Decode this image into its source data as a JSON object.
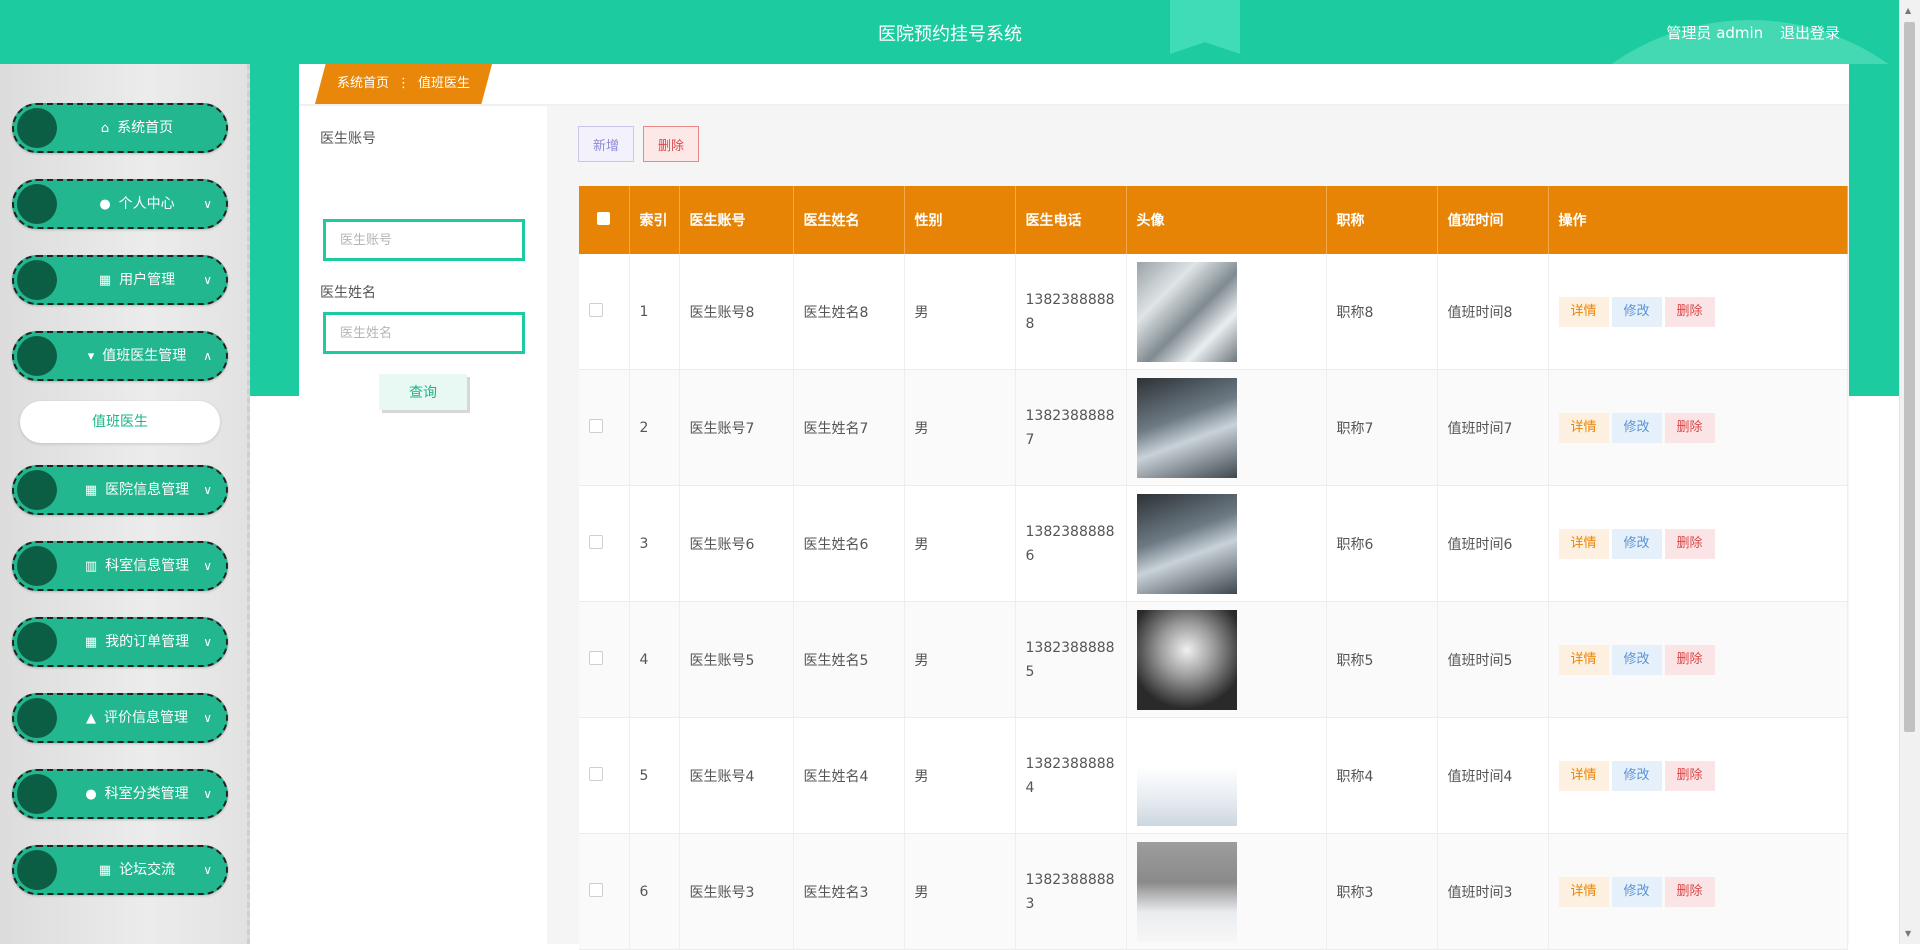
{
  "header": {
    "title": "医院预约挂号系统",
    "user": "管理员 admin",
    "logout": "退出登录"
  },
  "sidebar": {
    "items": [
      {
        "label": "系统首页",
        "icon": "home-icon",
        "glyph": "⌂",
        "chevron": ""
      },
      {
        "label": "个人中心",
        "icon": "user-icon",
        "glyph": "●",
        "chevron": "∨"
      },
      {
        "label": "用户管理",
        "icon": "grid-icon",
        "glyph": "▦",
        "chevron": "∨"
      },
      {
        "label": "值班医生管理",
        "icon": "pin-icon",
        "glyph": "▾",
        "chevron": "∧"
      },
      {
        "label": "医院信息管理",
        "icon": "grid-icon",
        "glyph": "▦",
        "chevron": "∨"
      },
      {
        "label": "科室信息管理",
        "icon": "book-icon",
        "glyph": "▥",
        "chevron": "∨"
      },
      {
        "label": "我的订单管理",
        "icon": "grid-icon",
        "glyph": "▦",
        "chevron": "∨"
      },
      {
        "label": "评价信息管理",
        "icon": "thumb-icon",
        "glyph": "▲",
        "chevron": "∨"
      },
      {
        "label": "科室分类管理",
        "icon": "user-icon",
        "glyph": "●",
        "chevron": "∨"
      },
      {
        "label": "论坛交流",
        "icon": "table-icon",
        "glyph": "▦",
        "chevron": "∨"
      }
    ],
    "active_sub": "值班医生"
  },
  "breadcrumb": {
    "home": "系统首页",
    "sep": "⋮",
    "current": "值班医生"
  },
  "filter": {
    "account_label": "医生账号",
    "account_placeholder": "医生账号",
    "name_label": "医生姓名",
    "name_placeholder": "医生姓名",
    "query": "查询"
  },
  "actions": {
    "add": "新增",
    "delete": "删除"
  },
  "table": {
    "headers": [
      "索引",
      "医生账号",
      "医生姓名",
      "性别",
      "医生电话",
      "头像",
      "职称",
      "值班时间",
      "操作"
    ],
    "rows": [
      {
        "idx": "1",
        "account": "医生账号8",
        "name": "医生姓名8",
        "gender": "男",
        "phone": "13823888888",
        "title": "职称8",
        "duty": "值班时间8"
      },
      {
        "idx": "2",
        "account": "医生账号7",
        "name": "医生姓名7",
        "gender": "男",
        "phone": "13823888887",
        "title": "职称7",
        "duty": "值班时间7"
      },
      {
        "idx": "3",
        "account": "医生账号6",
        "name": "医生姓名6",
        "gender": "男",
        "phone": "13823888886",
        "title": "职称6",
        "duty": "值班时间6"
      },
      {
        "idx": "4",
        "account": "医生账号5",
        "name": "医生姓名5",
        "gender": "男",
        "phone": "13823888885",
        "title": "职称5",
        "duty": "值班时间5"
      },
      {
        "idx": "5",
        "account": "医生账号4",
        "name": "医生姓名4",
        "gender": "男",
        "phone": "13823888884",
        "title": "职称4",
        "duty": "值班时间4"
      },
      {
        "idx": "6",
        "account": "医生账号3",
        "name": "医生姓名3",
        "gender": "男",
        "phone": "13823888883",
        "title": "职称3",
        "duty": "值班时间3"
      }
    ],
    "row_actions": {
      "detail": "详情",
      "edit": "修改",
      "delete": "删除"
    }
  },
  "colors": {
    "primary": "#1ccca0",
    "accent": "#e88405"
  }
}
